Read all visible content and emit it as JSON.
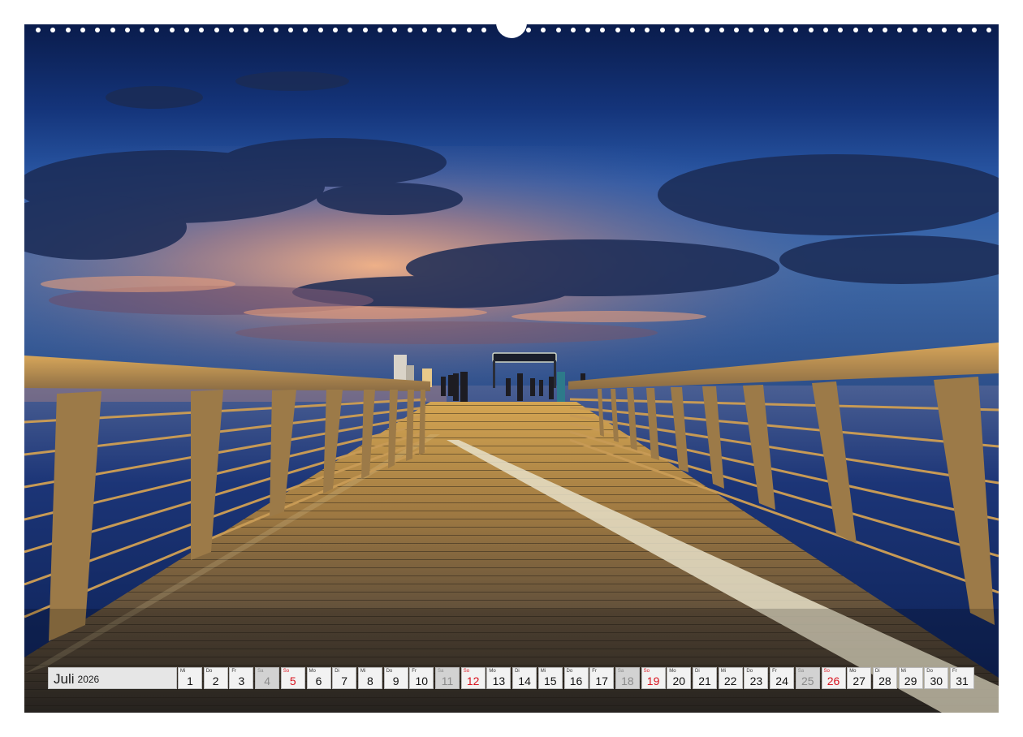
{
  "photo": {
    "subject": "pier-at-dusk",
    "colors": {
      "sky_top": "#0d2257",
      "sky_mid": "#244d9a",
      "horizon_glow": "#f0a27a",
      "sea": "#0f2a63",
      "boardwalk_light": "#c99a4a",
      "boardwalk_dark": "#3d3428",
      "railing": "#b28a4c",
      "center_line": "#e8e0c8"
    }
  },
  "calendar": {
    "month": "Juli",
    "year": "2026",
    "colors": {
      "weekday_cell": "#f2f2f2",
      "saturday_cell": "#d2d2d2",
      "sunday_text": "#d8141f",
      "border": "#b8b8b8"
    },
    "days": [
      {
        "weekday": "Mi",
        "number": "1",
        "kind": "weekday"
      },
      {
        "weekday": "Do",
        "number": "2",
        "kind": "weekday"
      },
      {
        "weekday": "Fr",
        "number": "3",
        "kind": "weekday"
      },
      {
        "weekday": "Sa",
        "number": "4",
        "kind": "sat"
      },
      {
        "weekday": "So",
        "number": "5",
        "kind": "sun"
      },
      {
        "weekday": "Mo",
        "number": "6",
        "kind": "weekday"
      },
      {
        "weekday": "Di",
        "number": "7",
        "kind": "weekday"
      },
      {
        "weekday": "Mi",
        "number": "8",
        "kind": "weekday"
      },
      {
        "weekday": "Do",
        "number": "9",
        "kind": "weekday"
      },
      {
        "weekday": "Fr",
        "number": "10",
        "kind": "weekday"
      },
      {
        "weekday": "Sa",
        "number": "11",
        "kind": "sat"
      },
      {
        "weekday": "So",
        "number": "12",
        "kind": "sun"
      },
      {
        "weekday": "Mo",
        "number": "13",
        "kind": "weekday"
      },
      {
        "weekday": "Di",
        "number": "14",
        "kind": "weekday"
      },
      {
        "weekday": "Mi",
        "number": "15",
        "kind": "weekday"
      },
      {
        "weekday": "Do",
        "number": "16",
        "kind": "weekday"
      },
      {
        "weekday": "Fr",
        "number": "17",
        "kind": "weekday"
      },
      {
        "weekday": "Sa",
        "number": "18",
        "kind": "sat"
      },
      {
        "weekday": "So",
        "number": "19",
        "kind": "sun"
      },
      {
        "weekday": "Mo",
        "number": "20",
        "kind": "weekday"
      },
      {
        "weekday": "Di",
        "number": "21",
        "kind": "weekday"
      },
      {
        "weekday": "Mi",
        "number": "22",
        "kind": "weekday"
      },
      {
        "weekday": "Do",
        "number": "23",
        "kind": "weekday"
      },
      {
        "weekday": "Fr",
        "number": "24",
        "kind": "weekday"
      },
      {
        "weekday": "Sa",
        "number": "25",
        "kind": "sat"
      },
      {
        "weekday": "So",
        "number": "26",
        "kind": "sun"
      },
      {
        "weekday": "Mo",
        "number": "27",
        "kind": "weekday"
      },
      {
        "weekday": "Di",
        "number": "28",
        "kind": "weekday"
      },
      {
        "weekday": "Mi",
        "number": "29",
        "kind": "weekday"
      },
      {
        "weekday": "Do",
        "number": "30",
        "kind": "weekday"
      },
      {
        "weekday": "Fr",
        "number": "31",
        "kind": "weekday"
      }
    ]
  }
}
